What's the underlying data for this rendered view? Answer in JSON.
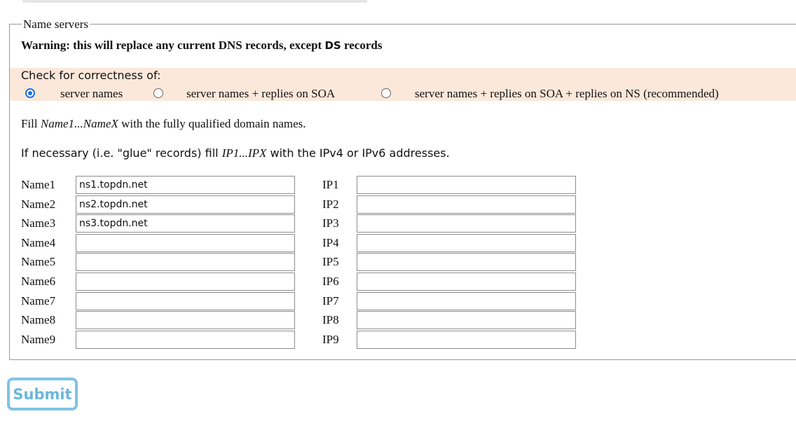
{
  "fieldset": {
    "legend": "Name servers"
  },
  "warning": {
    "prefix": "Warning: this will replace any current DNS records, except ",
    "code": "DS",
    "suffix": " records"
  },
  "check": {
    "label": "Check for correctness of:",
    "options": [
      {
        "label": "server names",
        "selected": true
      },
      {
        "label": "server names + replies on SOA",
        "selected": false
      },
      {
        "label": "server names + replies on SOA + replies on NS (recommended)",
        "selected": false
      }
    ]
  },
  "fill_names": {
    "pre": "Fill ",
    "em": "Name1...NameX",
    "post": " with the fully qualified domain names."
  },
  "fill_ips": {
    "pre": "If necessary (i.e. \"glue\" records) fill ",
    "em": "IP1...IPX",
    "post": " with the IPv4 or IPv6 addresses."
  },
  "rows": [
    {
      "name_label": "Name1",
      "name_value": "ns1.topdn.net",
      "ip_label": "IP1",
      "ip_value": ""
    },
    {
      "name_label": "Name2",
      "name_value": "ns2.topdn.net",
      "ip_label": "IP2",
      "ip_value": ""
    },
    {
      "name_label": "Name3",
      "name_value": "ns3.topdn.net",
      "ip_label": "IP3",
      "ip_value": ""
    },
    {
      "name_label": "Name4",
      "name_value": "",
      "ip_label": "IP4",
      "ip_value": ""
    },
    {
      "name_label": "Name5",
      "name_value": "",
      "ip_label": "IP5",
      "ip_value": ""
    },
    {
      "name_label": "Name6",
      "name_value": "",
      "ip_label": "IP6",
      "ip_value": ""
    },
    {
      "name_label": "Name7",
      "name_value": "",
      "ip_label": "IP7",
      "ip_value": ""
    },
    {
      "name_label": "Name8",
      "name_value": "",
      "ip_label": "IP8",
      "ip_value": ""
    },
    {
      "name_label": "Name9",
      "name_value": "",
      "ip_label": "IP9",
      "ip_value": ""
    }
  ],
  "submit_label": "Submit",
  "colors": {
    "check_bg": "#fce8da",
    "radio_accent": "#1a73e8",
    "submit_border": "#7ec3e3",
    "submit_text": "#6ab7dc"
  }
}
